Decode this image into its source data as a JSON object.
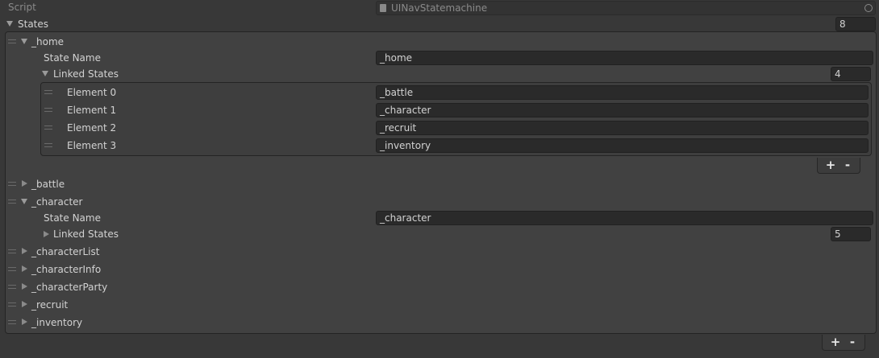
{
  "script_row": {
    "label": "Script",
    "value": "UINavStatemachine"
  },
  "states": {
    "label": "States",
    "count": "8",
    "items": [
      {
        "name": "_home",
        "state_name_label": "State Name",
        "state_name_value": "_home",
        "linked_label": "Linked States",
        "linked_count": "4",
        "elements": [
          {
            "label": "Element 0",
            "value": "_battle"
          },
          {
            "label": "Element 1",
            "value": "_character"
          },
          {
            "label": "Element 2",
            "value": "_recruit"
          },
          {
            "label": "Element 3",
            "value": "_inventory"
          }
        ]
      },
      {
        "name": "_battle"
      },
      {
        "name": "_character",
        "state_name_label": "State Name",
        "state_name_value": "_character",
        "linked_label": "Linked States",
        "linked_count": "5"
      },
      {
        "name": "_characterList"
      },
      {
        "name": "_characterInfo"
      },
      {
        "name": "_characterParty"
      },
      {
        "name": "_recruit"
      },
      {
        "name": "_inventory"
      }
    ]
  },
  "buttons": {
    "add": "+",
    "remove": "-"
  },
  "icons": {
    "script_file": "script-file-icon",
    "object_picker": "object-picker-icon"
  }
}
